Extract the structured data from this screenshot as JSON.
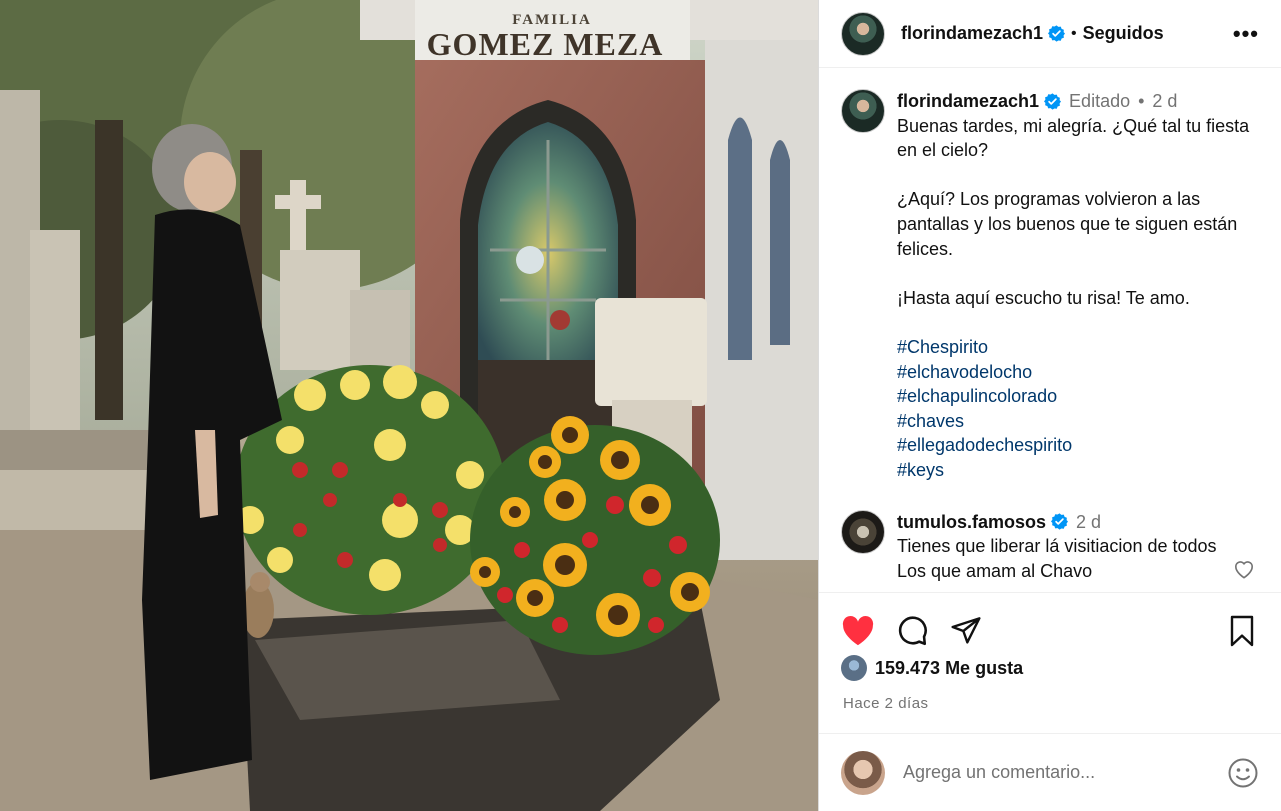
{
  "photo": {
    "crypt_family_label": "FAMILIA",
    "crypt_family_name": "GOMEZ MEZA"
  },
  "header": {
    "username": "florindamezach1",
    "separator": "•",
    "follow_status": "Seguidos",
    "more_label": "•••"
  },
  "caption": {
    "username": "florindamezach1",
    "edited": "Editado",
    "separator": "•",
    "time": "2 d",
    "line1": "Buenas tardes, mi alegría. ¿Qué tal tu fiesta en el cielo?",
    "line2": "¿Aquí? Los programas volvieron a las pantallas y los buenos que te siguen están felices.",
    "line3": "¡Hasta aquí escucho tu risa! Te amo.",
    "hashtags": [
      "#Chespirito",
      "#elchavodelocho",
      "#elchapulincolorado",
      "#chaves",
      "#ellegadodechespirito",
      "#keys"
    ]
  },
  "reply": {
    "username": "tumulos.famosos",
    "time": "2 d",
    "text": "Tienes que liberar lá visitiacion de todos Los que amam al Chavo"
  },
  "actions": {
    "like_icon": "heart-filled-icon",
    "comment_icon": "comment-icon",
    "share_icon": "share-icon",
    "save_icon": "bookmark-icon",
    "like_color": "#ff3040"
  },
  "likes": {
    "count": "159.473 Me gusta"
  },
  "date": "Hace 2 días",
  "composer": {
    "placeholder": "Agrega un comentario..."
  },
  "colors": {
    "verified": "#0095f6",
    "hashtag": "#00376b",
    "muted": "#737373"
  }
}
